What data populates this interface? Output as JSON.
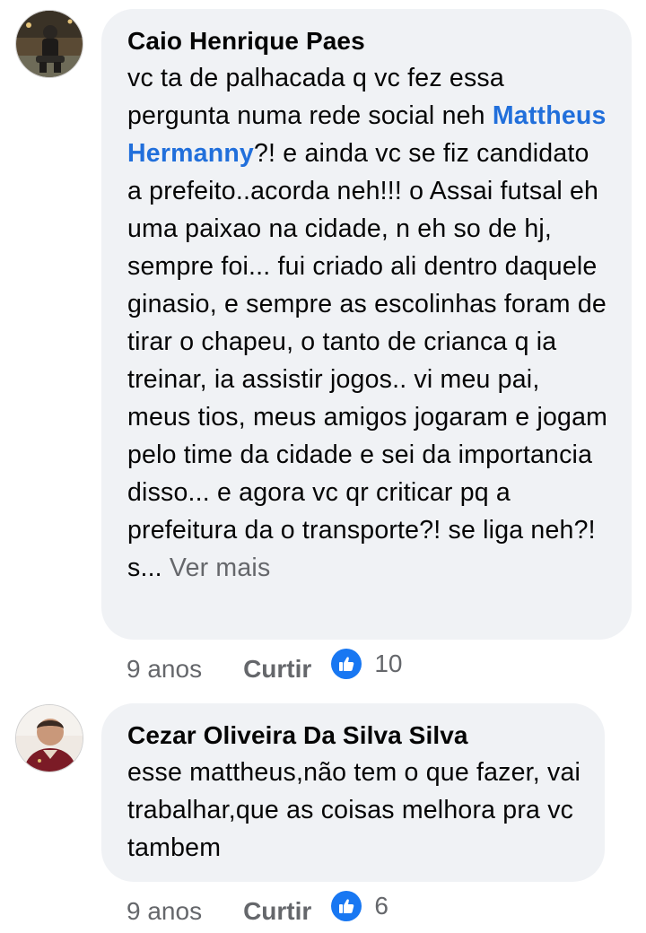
{
  "comments": [
    {
      "author": "Caio Henrique Paes",
      "text_before": "vc ta de palhacada q vc fez essa pergunta numa rede social neh ",
      "mention": "Mattheus Hermanny",
      "text_after": "?! e ainda vc se fiz candidato a prefeito..acorda neh!!! o Assai futsal eh uma paixao na cidade, n eh so de hj, sempre foi... fui criado ali dentro daquele ginasio, e sempre as escolinhas foram de tirar o chapeu, o tanto de crianca q ia treinar, ia assistir jogos.. vi meu pai, meus tios, meus amigos jogaram e jogam pelo time da cidade e sei da importancia disso... e agora vc qr criticar pq a prefeitura da o transporte?! se liga neh?! s...",
      "see_more": " Ver mais",
      "time": "9 anos",
      "like_label": "Curtir",
      "reaction_count": "10",
      "avatar_icon": "person-avatar-dark"
    },
    {
      "author": "Cezar Oliveira Da Silva Silva",
      "text": "esse mattheus,não tem o que fazer, vai trabalhar,que as coisas melhora pra vc tambem",
      "time": "9 anos",
      "like_label": "Curtir",
      "reaction_count": "6",
      "avatar_icon": "person-avatar-red"
    }
  ],
  "colors": {
    "bubble": "#f0f2f5",
    "mention": "#216fdb",
    "meta": "#65676b",
    "like_icon": "#1877f2"
  }
}
